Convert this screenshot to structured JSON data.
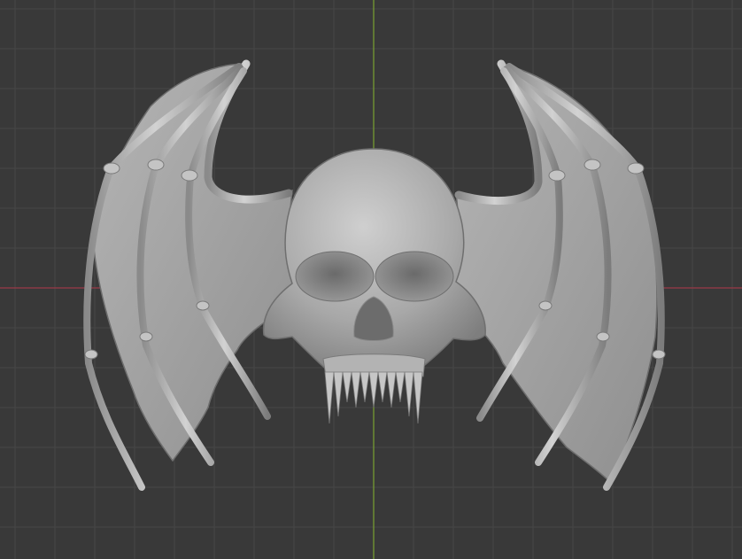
{
  "viewport": {
    "view": "top-orthographic",
    "grid_visible": true,
    "background_color": "#393939",
    "grid_color": "#464646",
    "x_axis_color": "#9a3a48",
    "y_axis_color": "#7aa332",
    "model_color": "#a6a6a6",
    "model": {
      "name": "winged-skull-sculpt",
      "parts": [
        "left-wing",
        "right-wing",
        "skull",
        "fangs"
      ]
    }
  }
}
